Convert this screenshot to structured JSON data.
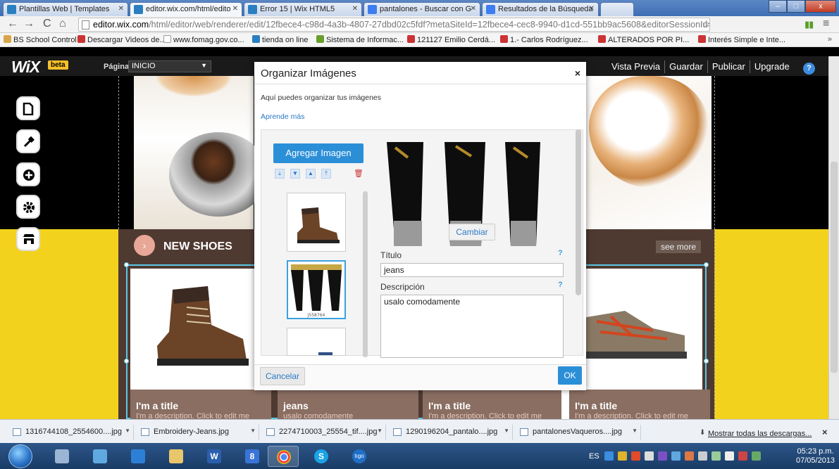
{
  "browser": {
    "tabs": [
      {
        "title": "Plantillas Web | Templates",
        "icon": "wix-icon"
      },
      {
        "title": "editor.wix.com/html/edito",
        "icon": "wix-icon"
      },
      {
        "title": "Error 15 | Wix HTML5",
        "icon": "wix-icon"
      },
      {
        "title": "pantalones - Buscar con G",
        "icon": "google-icon"
      },
      {
        "title": "Resultados de la Búsqueda",
        "icon": "google-icon"
      }
    ],
    "window_controls": {
      "minimize": "–",
      "maximize": "□",
      "close": "x"
    },
    "url_domain": "editor.wix.com",
    "url_path": "/html/editor/web/renderer/edit/12fbece4-c98d-4a3b-4807-27dbd02c5fdf?metaSiteId=12fbece4-cec8-9940-d1cd-551bb9ac5608&editorSessionId=547E90",
    "bookmarks": [
      "BS School Control",
      "Descargar Videos de...",
      "www.fomag.gov.co...",
      "tienda on line",
      "Sistema de Informac...",
      "121127 Emilio Cerdá...",
      "1.- Carlos Rodríguez...",
      "ALTERADOS POR PI...",
      "Interés Simple e Inte..."
    ],
    "bookmarks_more": "»"
  },
  "editor": {
    "logo": "WiX",
    "beta": "beta",
    "page_label": "Página",
    "page_selected": "INICIO",
    "nav": [
      "Vista Previa",
      "Guardar",
      "Publicar",
      "Upgrade"
    ],
    "help": "?"
  },
  "site": {
    "section_title": "NEW SHOES",
    "see_more": "see more",
    "cards": [
      {
        "title": "I'm a title",
        "desc": "I'm a description. Click to edit me"
      },
      {
        "title": "jeans",
        "desc": "usalo comodamente"
      },
      {
        "title": "I'm a title",
        "desc": "I'm a description. Click to edit me"
      },
      {
        "title": "I'm a title",
        "desc": "I'm a description. Click to edit me"
      }
    ]
  },
  "modal": {
    "title": "Organizar Imágenes",
    "close": "×",
    "subtitle": "Aquí puedes organizar tus imágenes",
    "learn_more": "Aprende más",
    "add_image": "Agregar Imagen",
    "change": "Cambiar",
    "title_label": "Título",
    "title_value": "jeans",
    "desc_label": "Descripción",
    "desc_value": "usalo comodamente",
    "help_mark": "?",
    "cancel": "Cancelar",
    "ok": "OK",
    "thumb_caption": "J558764"
  },
  "downloads": {
    "items": [
      "1316744108_2554600....jpg",
      "Embroidery-Jeans.jpg",
      "2274710003_25554_tif....jpg",
      "1290196204_pantalo....jpg",
      "pantalonesVaqueros....jpg"
    ],
    "show_all": "Mostrar todas las descargas...",
    "close": "×"
  },
  "taskbar": {
    "lang": "ES",
    "time": "05:23 p.m.",
    "date": "07/05/2013",
    "app_label_tigo": "tıgo"
  }
}
